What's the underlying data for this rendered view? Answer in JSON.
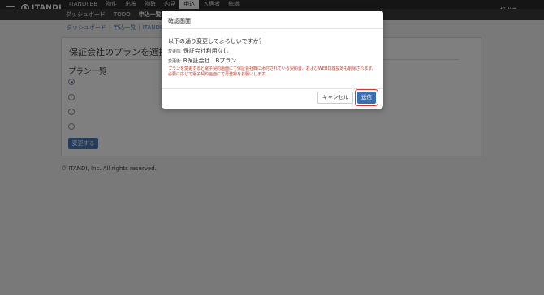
{
  "header": {
    "logo": "ITANDI",
    "nav": [
      "ITANDI BB",
      "物件",
      "出稿",
      "物確",
      "内見",
      "申込",
      "入居者",
      "修繕"
    ],
    "active_nav": "申込",
    "user": "担当者"
  },
  "subnav": {
    "items": [
      "ダッシュボード",
      "TODO",
      "申込一覧"
    ],
    "active": "申込一覧"
  },
  "breadcrumb": [
    "ダッシュボード",
    "申込一覧",
    "ITANDI デ"
  ],
  "page": {
    "title": "保証会社のプランを選択して",
    "plan_list_title": "プラン一覧",
    "radios": [
      {
        "checked": true
      },
      {
        "checked": false
      },
      {
        "checked": false
      },
      {
        "checked": false
      }
    ],
    "change_button": "変更する"
  },
  "footer": "© ITANDI, Inc. All rights reserved.",
  "modal": {
    "title": "確認画面",
    "question": "以下の通り変更してよろしいですか？",
    "before_label": "変更前:",
    "before_value": "保証会社利用なし",
    "after_label": "変更後:",
    "after_value": "B保証会社　Bプラン",
    "warning": "プランを変更すると電子契約画面にて保証会社欄に添付されている契約書、およびWEB口座設定も削除されます。必要に応じて電子契約画面にて再登録をお願いします。",
    "cancel": "キャンセル",
    "submit": "送信"
  }
}
